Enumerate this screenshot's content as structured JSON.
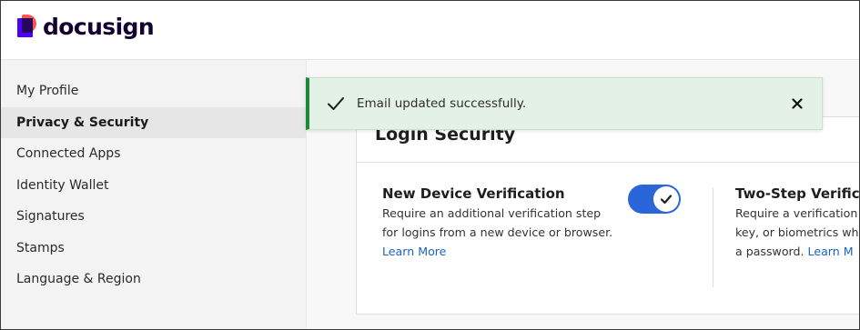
{
  "header": {
    "logo_text": "docusign"
  },
  "sidebar": {
    "items": [
      {
        "label": "My Profile",
        "active": false
      },
      {
        "label": "Privacy & Security",
        "active": true
      },
      {
        "label": "Connected Apps",
        "active": false
      },
      {
        "label": "Identity Wallet",
        "active": false
      },
      {
        "label": "Signatures",
        "active": false
      },
      {
        "label": "Stamps",
        "active": false
      },
      {
        "label": "Language & Region",
        "active": false
      }
    ]
  },
  "toast": {
    "message": "Email updated successfully.",
    "icon": "check-icon",
    "close_icon": "close-icon",
    "accent": "#1d8a3a"
  },
  "login_security": {
    "title": "Login Security",
    "new_device": {
      "title": "New Device Verification",
      "desc_line1": "Require an additional verification step",
      "desc_line2": "for logins from a new device or browser.",
      "link": "Learn More",
      "enabled": true
    },
    "two_step": {
      "title": "Two-Step Verifica",
      "desc_line1": "Require a verification",
      "desc_line2": "key, or biometrics wh",
      "desc_line3_text": "a password. ",
      "link": "Learn M"
    }
  },
  "colors": {
    "brand": "#4c00ff",
    "link": "#1b61c9",
    "toggle": "#2b66d9"
  }
}
